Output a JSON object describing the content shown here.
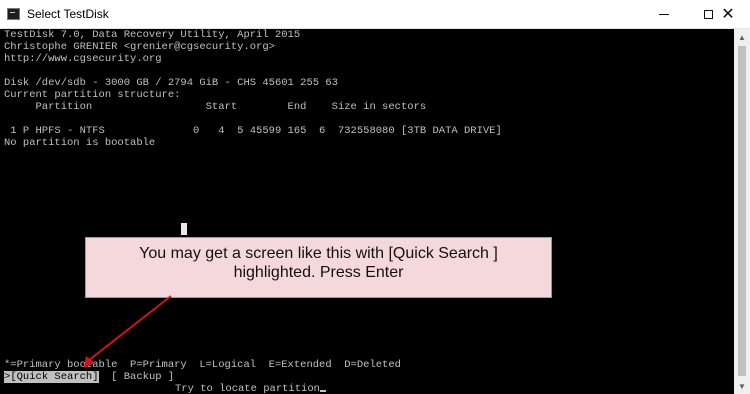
{
  "window": {
    "title": "Select TestDisk",
    "minimize_glyph": "",
    "maximize_glyph": "",
    "close_glyph": "✕"
  },
  "console": {
    "header_line1": "TestDisk 7.0, Data Recovery Utility, April 2015",
    "header_line2": "Christophe GRENIER <grenier@cgsecurity.org>",
    "header_line3": "http://www.cgsecurity.org",
    "disk_line": "Disk /dev/sdb - 3000 GB / 2794 GiB - CHS 45601 255 63",
    "structure_label": "Current partition structure:",
    "table_header": "     Partition                  Start        End    Size in sectors",
    "partition_row": " 1 P HPFS - NTFS              0   4  5 45599 165  6  732558080 [3TB DATA DRIVE]",
    "boot_status": "No partition is bootable",
    "legend_line": "*=Primary bootable  P=Primary  L=Logical  E=Extended  D=Deleted",
    "menu_prefix": ">",
    "menu_quick_search": "[Quick Search]",
    "menu_backup": "[ Backup ]",
    "hint": "Try to locate partition"
  },
  "callout": {
    "line1": "You may get a screen like this with [Quick Search ]",
    "line2": "highlighted. Press Enter",
    "background": "#f5d8dc",
    "arrow_color": "#d0141a"
  }
}
